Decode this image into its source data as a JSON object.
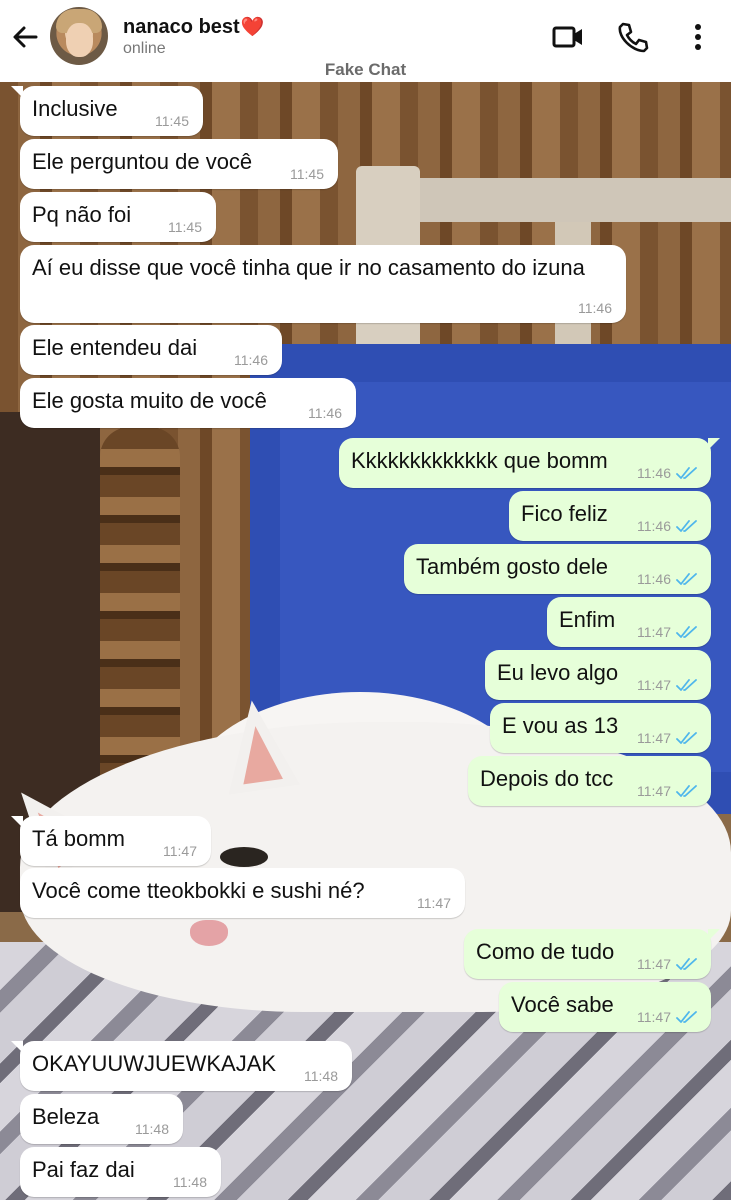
{
  "header": {
    "contact_name": "nanaco best",
    "heart": "❤️",
    "status": "online",
    "watermark": "Fake Chat",
    "icons": [
      "back-arrow-icon",
      "video-call-icon",
      "phone-call-icon",
      "more-vertical-icon"
    ]
  },
  "colors": {
    "incoming_bubble": "#ffffff",
    "outgoing_bubble": "#e6ffd9",
    "read_ticks": "#4fb6ec"
  },
  "messages": [
    {
      "dir": "in",
      "text": "Inclusive",
      "time": "11:45"
    },
    {
      "dir": "in",
      "text": "Ele perguntou de você",
      "time": "11:45"
    },
    {
      "dir": "in",
      "text": "Pq não foi",
      "time": "11:45"
    },
    {
      "dir": "in",
      "text": "Aí eu disse que você tinha que ir no casamento do izuna",
      "time": "11:46"
    },
    {
      "dir": "in",
      "text": "Ele entendeu dai",
      "time": "11:46"
    },
    {
      "dir": "in",
      "text": "Ele gosta muito de você",
      "time": "11:46"
    },
    {
      "dir": "out",
      "text": "Kkkkkkkkkkkkk que bomm",
      "time": "11:46",
      "status": "read"
    },
    {
      "dir": "out",
      "text": "Fico feliz",
      "time": "11:46",
      "status": "read"
    },
    {
      "dir": "out",
      "text": "Também gosto dele",
      "time": "11:46",
      "status": "read"
    },
    {
      "dir": "out",
      "text": "Enfim",
      "time": "11:47",
      "status": "read"
    },
    {
      "dir": "out",
      "text": "Eu levo algo",
      "time": "11:47",
      "status": "read"
    },
    {
      "dir": "out",
      "text": "E vou as 13",
      "time": "11:47",
      "status": "read"
    },
    {
      "dir": "out",
      "text": "Depois do tcc",
      "time": "11:47",
      "status": "read"
    },
    {
      "dir": "in",
      "text": "Tá bomm",
      "time": "11:47"
    },
    {
      "dir": "in",
      "text": "Você come tteokbokki e sushi né?",
      "time": "11:47"
    },
    {
      "dir": "out",
      "text": "Como de tudo",
      "time": "11:47",
      "status": "read"
    },
    {
      "dir": "out",
      "text": "Você sabe",
      "time": "11:47",
      "status": "read"
    },
    {
      "dir": "in",
      "text": "OKAYUUWJUEWKAJAK",
      "time": "11:48"
    },
    {
      "dir": "in",
      "text": "Beleza",
      "time": "11:48"
    },
    {
      "dir": "in",
      "text": "Pai faz dai",
      "time": "11:48"
    }
  ]
}
